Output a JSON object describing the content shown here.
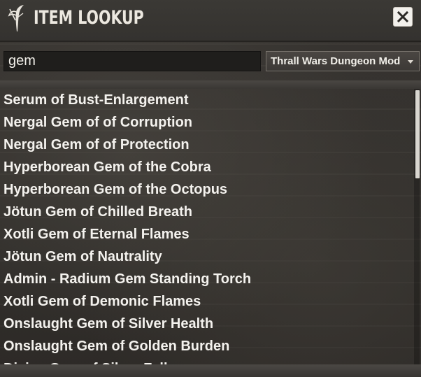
{
  "window": {
    "title": "ITEM LOOKUP",
    "logo_icon": "feather-sword-icon",
    "close_icon": "close-icon"
  },
  "search": {
    "value": "gem",
    "placeholder": ""
  },
  "mod_filter": {
    "selected": "Thrall Wars Dungeon Mod",
    "caret_icon": "chevron-down-icon"
  },
  "results": [
    "Serum of Bust-Enlargement",
    "Nergal Gem of of Corruption",
    "Nergal Gem of of Protection",
    "Hyperborean Gem of the Cobra",
    "Hyperborean Gem of the Octopus",
    "Jötun Gem of Chilled Breath",
    "Xotli Gem of Eternal Flames",
    "Jötun Gem of Nautrality",
    "Admin - Radium Gem Standing Torch",
    "Xotli Gem of Demonic Flames",
    "Onslaught Gem of Silver Health",
    "Onslaught Gem of Golden Burden",
    "Divine Gem of Silver Falls"
  ],
  "colors": {
    "text": "#f4f2ee",
    "panel": "#36332f",
    "input_bg": "#1f1e1c"
  }
}
